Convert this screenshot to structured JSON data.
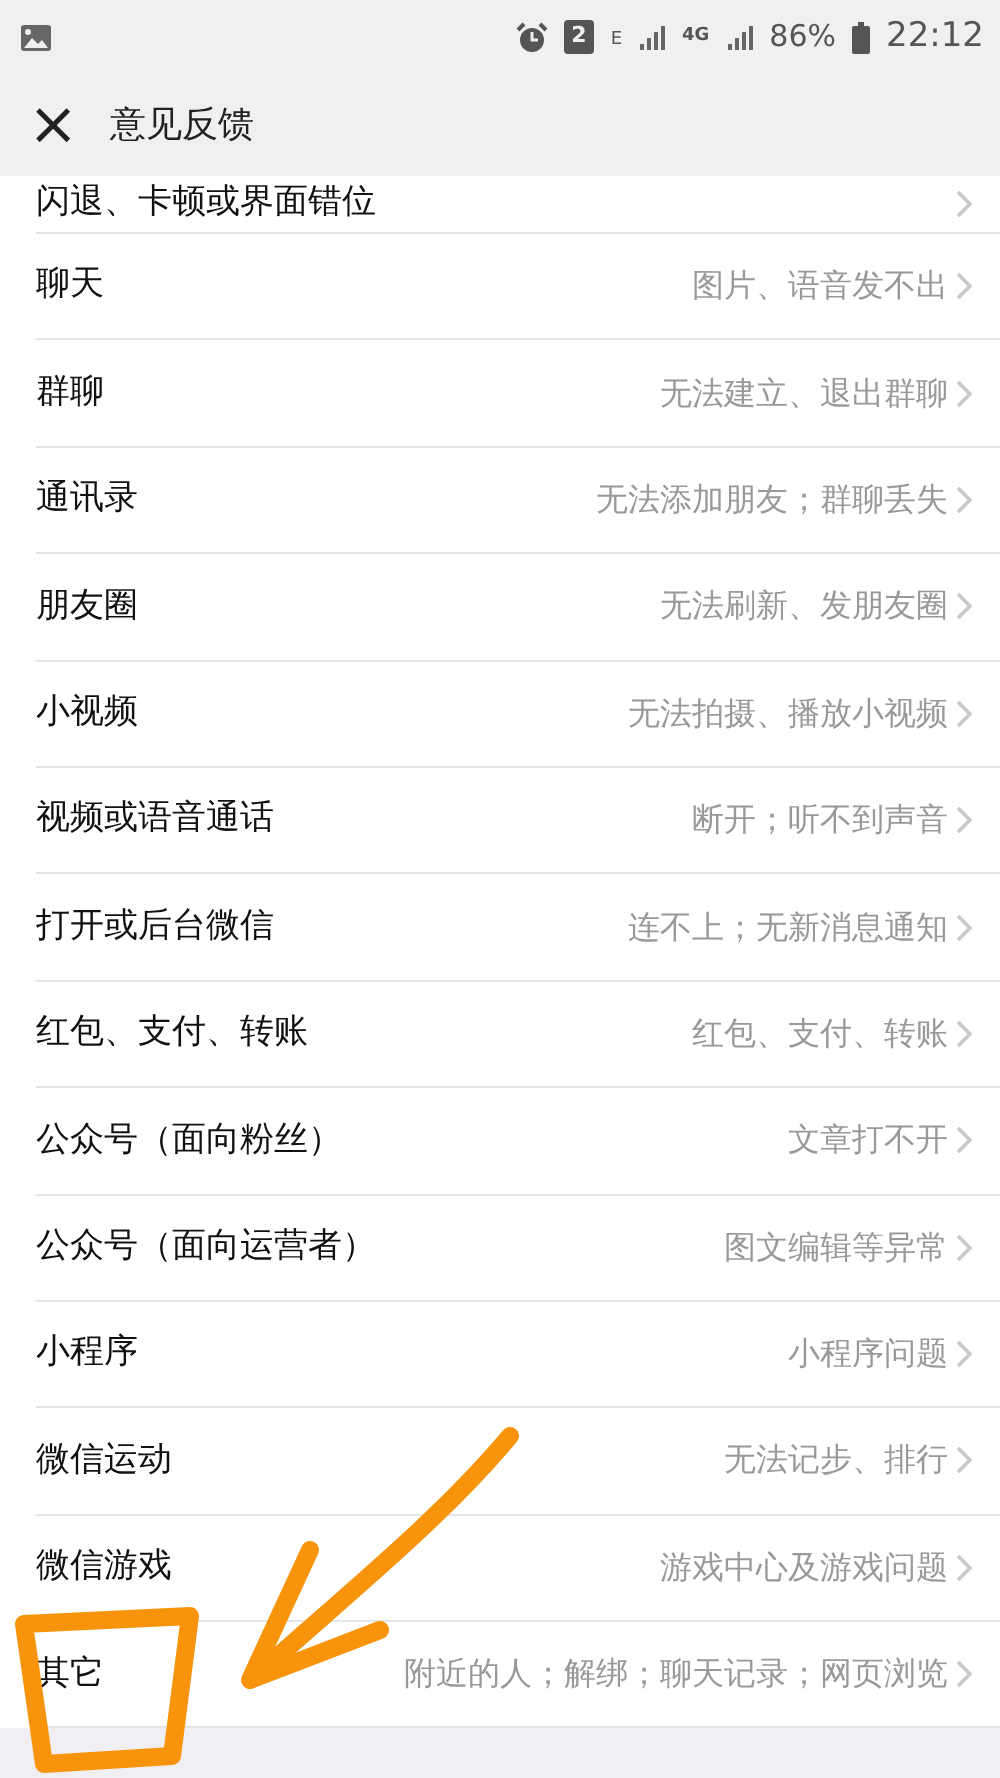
{
  "status_bar": {
    "sim_slot": "2",
    "network_1": "E",
    "network_2": "4G",
    "battery": "86%",
    "time": "22:12"
  },
  "header": {
    "close": "×",
    "title": "意见反馈"
  },
  "rows": [
    {
      "label": "闪退、卡顿或界面错位"
    },
    {
      "label": "聊天",
      "detail": "图片、语音发不出"
    },
    {
      "label": "群聊",
      "detail": "无法建立、退出群聊"
    },
    {
      "label": "通讯录",
      "detail": "无法添加朋友；群聊丢失"
    },
    {
      "label": "朋友圈",
      "detail": "无法刷新、发朋友圈"
    },
    {
      "label": "小视频",
      "detail": "无法拍摄、播放小视频"
    },
    {
      "label": "视频或语音通话",
      "detail": "断开；听不到声音"
    },
    {
      "label": "打开或后台微信",
      "detail": "连不上；无新消息通知"
    },
    {
      "label": "红包、支付、转账",
      "detail": "红包、支付、转账"
    },
    {
      "label": "公众号（面向粉丝）",
      "detail": "文章打不开"
    },
    {
      "label": "公众号（面向运营者）",
      "detail": "图文编辑等异常"
    },
    {
      "label": "小程序",
      "detail": "小程序问题"
    },
    {
      "label": "微信运动",
      "detail": "无法记步、排行"
    },
    {
      "label": "微信游戏",
      "detail": "游戏中心及游戏问题"
    },
    {
      "label": "其它",
      "detail": "附近的人；解绑；聊天记录；网页浏览"
    }
  ]
}
